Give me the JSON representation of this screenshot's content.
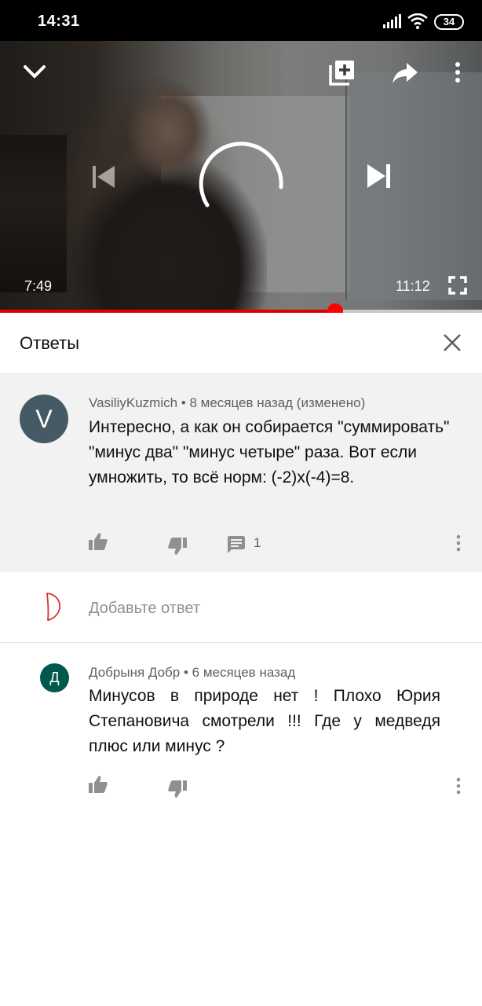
{
  "status_bar": {
    "time": "14:31",
    "battery": "34",
    "icons": [
      "signal-icon",
      "wifi-icon",
      "battery-icon"
    ]
  },
  "player": {
    "elapsed": "7:49",
    "duration": "11:12",
    "progress_fraction": 0.696,
    "accent": "#ff0000",
    "icons": [
      "chevron-down-icon",
      "add-to-playlist-icon",
      "share-icon",
      "more-vert-icon",
      "previous-icon",
      "next-icon",
      "fullscreen-icon",
      "loading-spinner"
    ]
  },
  "replies_panel": {
    "title": "Ответы",
    "close_icon": "close-icon"
  },
  "main_comment": {
    "avatar_letter": "V",
    "avatar_color": "#455a64",
    "author": "VasiliyKuzmich",
    "meta": "• 8 месяцев назад (изменено)",
    "text": "Интересно, а как он собирается \"суммировать\" \"минус два\" \"минус четыре\" раза. Вот если умножить, то всё норм: (-2)x(-4)=8.",
    "reply_count": "1",
    "icons": [
      "like-icon",
      "dislike-icon",
      "reply-icon",
      "more-vert-icon"
    ]
  },
  "add_reply": {
    "placeholder": "Добавьте ответ"
  },
  "reply_comment": {
    "avatar_letter": "Д",
    "avatar_color": "#00594c",
    "author": "Добрыня Добр",
    "meta": "• 6 месяцев назад",
    "text": "Минусов в природе нет ! Плохо Юрия Степановича смотрели !!! Где у медведя плюс или минус ?",
    "icons": [
      "like-icon",
      "dislike-icon",
      "more-vert-icon"
    ]
  }
}
